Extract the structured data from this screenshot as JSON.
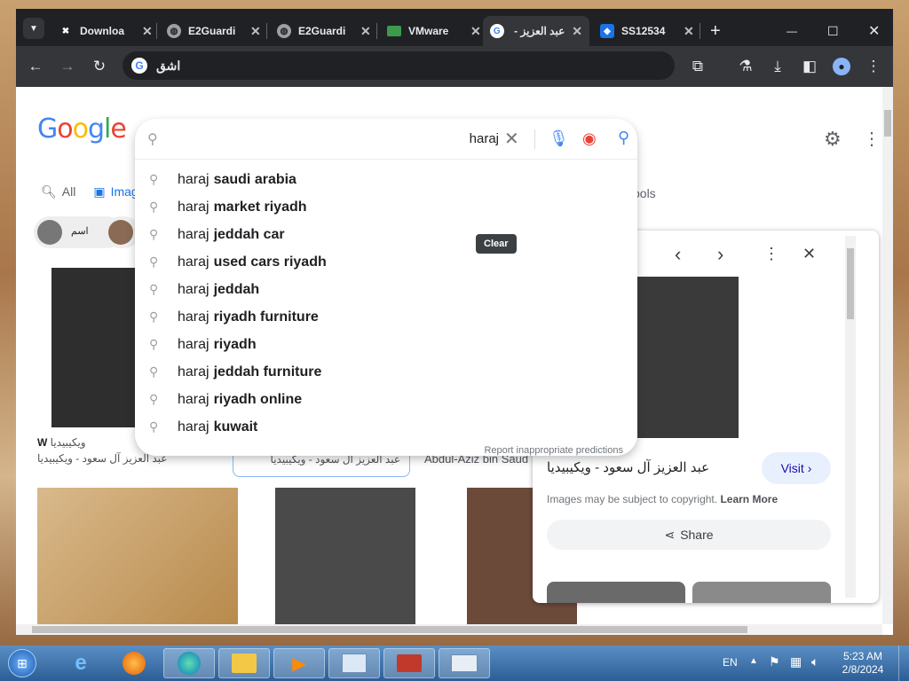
{
  "tabs": [
    {
      "label": "Downloa",
      "icon": "download-icon"
    },
    {
      "label": "E2Guardi",
      "icon": "globe-icon"
    },
    {
      "label": "E2Guardi",
      "icon": "globe-icon"
    },
    {
      "label": "VMware",
      "icon": "vmware-icon"
    },
    {
      "label": "عبد العزيز -",
      "icon": "google-icon",
      "active": true
    },
    {
      "label": "SS12534",
      "icon": "ss-icon"
    }
  ],
  "window": {
    "minimize": "—",
    "maximize": "☐",
    "close": "✕",
    "new_tab": "+"
  },
  "omnibox": {
    "value": "اشق"
  },
  "google": {
    "logo": [
      "G",
      "o",
      "o",
      "g",
      "l",
      "e"
    ],
    "logo_colors": [
      "#4285F4",
      "#EA4335",
      "#FBBC05",
      "#4285F4",
      "#34A853",
      "#EA4335"
    ],
    "tab_all": "All",
    "tab_images": "Images",
    "tools": "Tools",
    "chip_text": "اسم"
  },
  "search": {
    "value": "haraj",
    "clear_tooltip": "Clear",
    "suggestions": [
      {
        "prefix": "haraj",
        "completion": "saudi arabia"
      },
      {
        "prefix": "haraj",
        "completion": "market riyadh"
      },
      {
        "prefix": "haraj",
        "completion": "jeddah car"
      },
      {
        "prefix": "haraj",
        "completion": "used cars riyadh"
      },
      {
        "prefix": "haraj",
        "completion": "jeddah"
      },
      {
        "prefix": "haraj",
        "completion": "riyadh furniture"
      },
      {
        "prefix": "haraj",
        "completion": "riyadh"
      },
      {
        "prefix": "haraj",
        "completion": "jeddah furniture"
      },
      {
        "prefix": "haraj",
        "completion": "riyadh online"
      },
      {
        "prefix": "haraj",
        "completion": "kuwait"
      }
    ],
    "report": "Report inappropriate predictions"
  },
  "results": {
    "source1": "ويكيبيديا",
    "title1": "عبد العزيز آل سعود - ويكيبيديا",
    "title2": "عبد العزيز آل سعود - ويكيبيديا",
    "title3": "Abdul-Aziz bin Saud"
  },
  "panel": {
    "title": "عبد العزيز آل سعود - ويكيبيديا",
    "visit": "Visit",
    "copyright": "Images may be subject to copyright.",
    "learn_more": "Learn More",
    "share": "Share"
  },
  "taskbar": {
    "lang": "EN",
    "time": "5:23 AM",
    "date": "2/8/2024"
  }
}
